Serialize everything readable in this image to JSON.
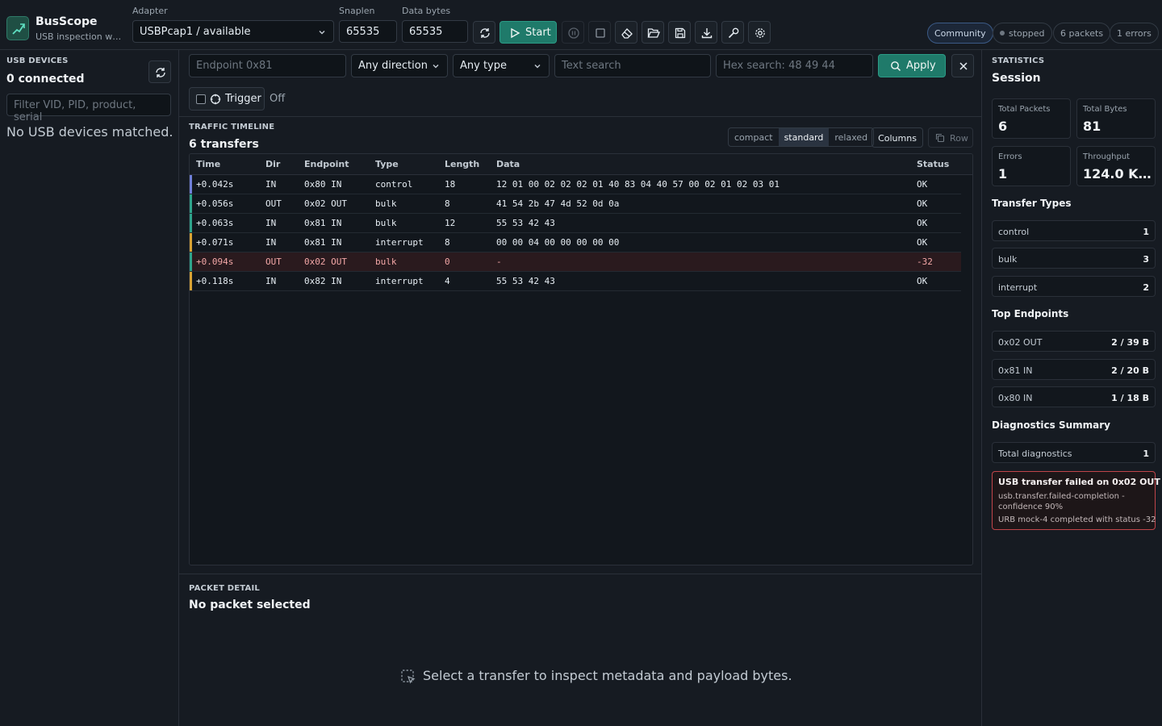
{
  "app": {
    "name": "BusScope",
    "subtitle": "USB inspection workbench"
  },
  "toolbar": {
    "adapter_label": "Adapter",
    "adapter_value": "USBPcap1 / available",
    "snaplen_label": "Snaplen",
    "snaplen_value": "65535",
    "databytes_label": "Data bytes",
    "databytes_value": "65535",
    "start_label": "Start"
  },
  "status": {
    "edition": "Community",
    "state": "stopped",
    "packets": "6 packets",
    "errors": "1 errors"
  },
  "devices": {
    "section_label": "USB DEVICES",
    "count_label": "0 connected",
    "filter_placeholder": "Filter VID, PID, product, serial",
    "empty_text": "No USB devices matched."
  },
  "filters": {
    "endpoint_placeholder": "Endpoint 0x81",
    "direction_value": "Any direction",
    "type_value": "Any type",
    "text_placeholder": "Text search",
    "hex_placeholder": "Hex search: 48 49 44",
    "apply_label": "Apply",
    "trigger_label": "Trigger",
    "trigger_state": "Off"
  },
  "timeline": {
    "section_label": "TRAFFIC TIMELINE",
    "count_label": "6 transfers",
    "density_options": [
      "compact",
      "standard",
      "relaxed"
    ],
    "density_selected": "standard",
    "columns_label": "Columns",
    "row_label": "Row",
    "headers": [
      "Time",
      "Dir",
      "Endpoint",
      "Type",
      "Length",
      "Data",
      "Status"
    ],
    "rows": [
      {
        "time": "+0.042s",
        "dir": "IN",
        "endpoint": "0x80 IN",
        "type": "control",
        "length": "18",
        "data": "12 01 00 02 02 02 01 40 83 04 40 57 00 02 01 02 03 01",
        "status": "OK",
        "accent": "#6f7fd8",
        "error": false
      },
      {
        "time": "+0.056s",
        "dir": "OUT",
        "endpoint": "0x02 OUT",
        "type": "bulk",
        "length": "8",
        "data": "41 54 2b 47 4d 52 0d 0a",
        "status": "OK",
        "accent": "#2fa48c",
        "error": false
      },
      {
        "time": "+0.063s",
        "dir": "IN",
        "endpoint": "0x81 IN",
        "type": "bulk",
        "length": "12",
        "data": "55 53 42 43",
        "status": "OK",
        "accent": "#2fa48c",
        "error": false
      },
      {
        "time": "+0.071s",
        "dir": "IN",
        "endpoint": "0x81 IN",
        "type": "interrupt",
        "length": "8",
        "data": "00 00 04 00 00 00 00 00",
        "status": "OK",
        "accent": "#d9a334",
        "error": false
      },
      {
        "time": "+0.094s",
        "dir": "OUT",
        "endpoint": "0x02 OUT",
        "type": "bulk",
        "length": "0",
        "data": "-",
        "status": "-32",
        "accent": "#2fa48c",
        "error": true
      },
      {
        "time": "+0.118s",
        "dir": "IN",
        "endpoint": "0x82 IN",
        "type": "interrupt",
        "length": "4",
        "data": "55 53 42 43",
        "status": "OK",
        "accent": "#d9a334",
        "error": false
      }
    ]
  },
  "detail": {
    "section_label": "PACKET DETAIL",
    "title": "No packet selected",
    "hint": "Select a transfer to inspect metadata and payload bytes."
  },
  "stats": {
    "section_label": "STATISTICS",
    "title": "Session",
    "cards": [
      {
        "label": "Total Packets",
        "value": "6"
      },
      {
        "label": "Total Bytes",
        "value": "81"
      },
      {
        "label": "Errors",
        "value": "1"
      },
      {
        "label": "Throughput",
        "value": "124.0 Kb..."
      }
    ],
    "transfer_types_title": "Transfer Types",
    "transfer_types": [
      {
        "name": "control",
        "count": "1"
      },
      {
        "name": "bulk",
        "count": "3"
      },
      {
        "name": "interrupt",
        "count": "2"
      }
    ],
    "endpoints_title": "Top Endpoints",
    "endpoints": [
      {
        "name": "0x02 OUT",
        "value": "2 / 39 B"
      },
      {
        "name": "0x81 IN",
        "value": "2 / 20 B"
      },
      {
        "name": "0x80 IN",
        "value": "1 / 18 B"
      }
    ],
    "diagnostics_title": "Diagnostics Summary",
    "diagnostics_total_label": "Total diagnostics",
    "diagnostics_total": "1",
    "diagnostic": {
      "title": "USB transfer failed on 0x02 OUT",
      "code": "usb.transfer.failed-completion - confidence 90%",
      "message": "URB mock-4 completed with status -32"
    }
  }
}
